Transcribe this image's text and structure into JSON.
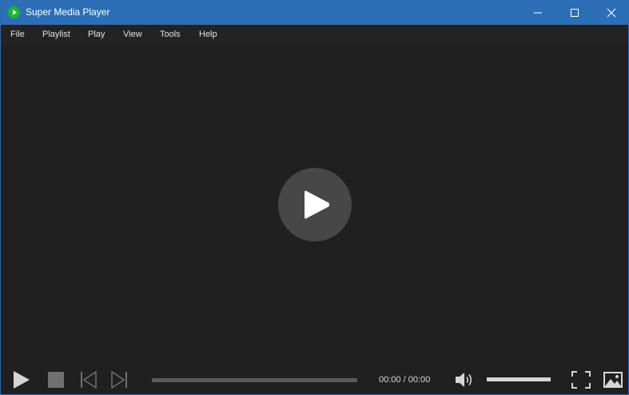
{
  "window": {
    "title": "Super Media Player",
    "icon": "green-play-icon",
    "controls": [
      "minimize-icon",
      "maximize-icon",
      "close-icon"
    ],
    "colors": {
      "titlebar": "#2d6fb6",
      "app_icon": "#19b92d",
      "background": "#202020"
    }
  },
  "menu": {
    "items": [
      "File",
      "Playlist",
      "Play",
      "View",
      "Tools",
      "Help"
    ]
  },
  "video": {
    "center_button": "play-icon"
  },
  "controls": {
    "buttons": [
      "play-icon",
      "stop-icon",
      "previous-icon",
      "next-icon",
      "volume-icon",
      "fullscreen-icon",
      "snapshot-icon"
    ],
    "time": "00:00 / 00:00",
    "seek_progress": 0,
    "volume_level": 1.0
  }
}
